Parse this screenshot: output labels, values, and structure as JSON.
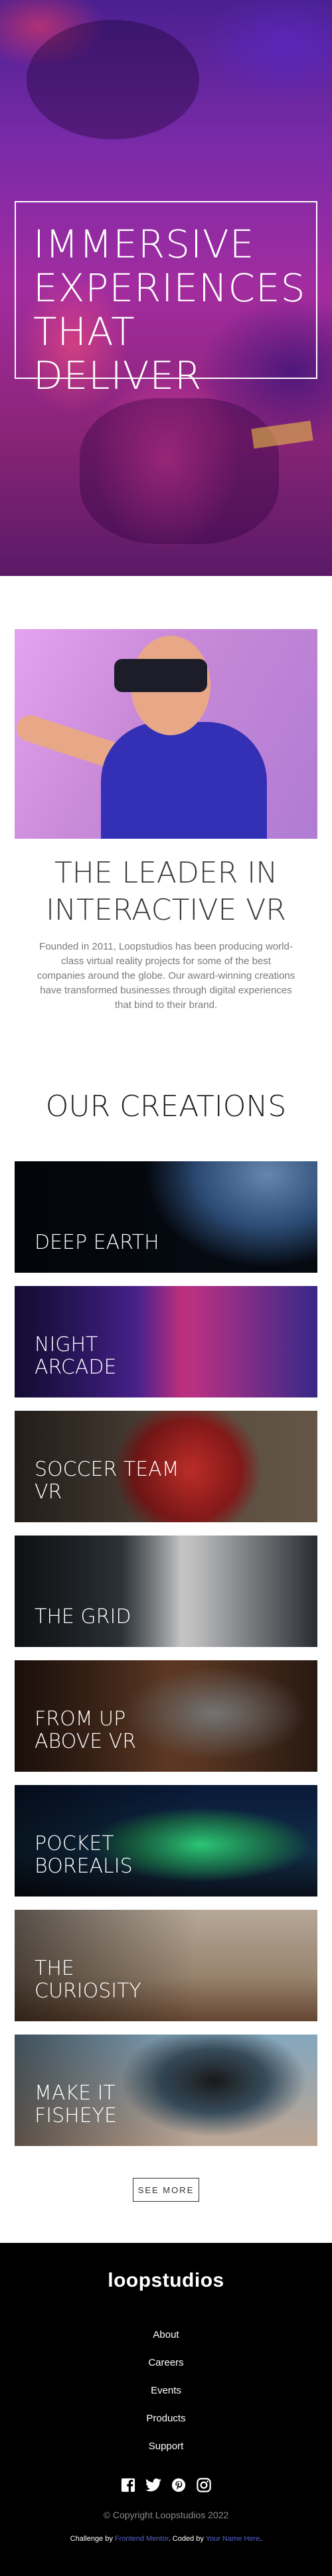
{
  "hero": {
    "headline": "Immersive experiences that deliver"
  },
  "about": {
    "title": "The leader in interactive VR",
    "body": "Founded in 2011, Loopstudios has been producing world-class virtual reality projects for some of the best companies around the globe. Our award-winning creations have transformed businesses through digital experiences that bind to their brand."
  },
  "creations": {
    "title": "Our creations",
    "items": [
      {
        "label": "Deep earth"
      },
      {
        "label": "Night arcade"
      },
      {
        "label": "Soccer team VR"
      },
      {
        "label": "The grid"
      },
      {
        "label": "From up above VR"
      },
      {
        "label": "Pocket borealis"
      },
      {
        "label": "The curiosity"
      },
      {
        "label": "Make it fisheye"
      }
    ],
    "see_more": "See more"
  },
  "footer": {
    "logo": "loopstudios",
    "nav": [
      "About",
      "Careers",
      "Events",
      "Products",
      "Support"
    ],
    "socials": [
      "facebook-icon",
      "twitter-icon",
      "pinterest-icon",
      "instagram-icon"
    ],
    "copyright": "© Copyright Loopstudios 2022",
    "credit_prefix": "Challenge by",
    "credit_challenge": "Frontend Mentor",
    "credit_middle": ". Coded by",
    "credit_author": "Your Name Here",
    "credit_suffix": "."
  }
}
